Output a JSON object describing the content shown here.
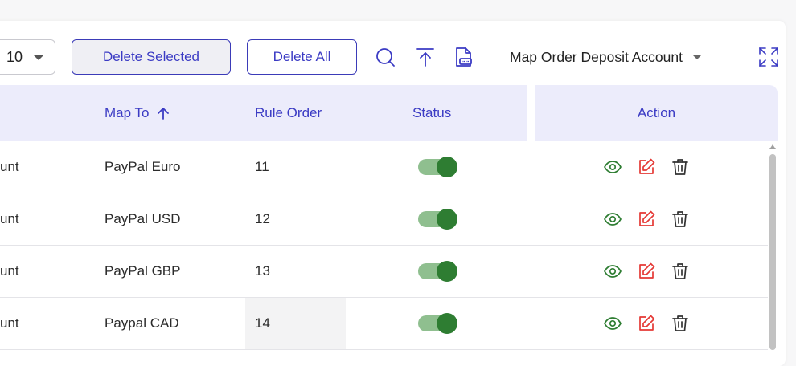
{
  "toolbar": {
    "page_size": "10",
    "delete_selected_label": "Delete Selected",
    "delete_all_label": "Delete All",
    "map_dropdown_label": "Map Order Deposit Account"
  },
  "table": {
    "headers": {
      "map_to": "Map To",
      "rule_order": "Rule Order",
      "status": "Status",
      "action": "Action"
    },
    "rows": [
      {
        "account": "unt",
        "map_to": "PayPal Euro",
        "rule_order": "11",
        "status": true
      },
      {
        "account": "unt",
        "map_to": "PayPal USD",
        "rule_order": "12",
        "status": true
      },
      {
        "account": "unt",
        "map_to": "PayPal GBP",
        "rule_order": "13",
        "status": true
      },
      {
        "account": "unt",
        "map_to": "Paypal CAD",
        "rule_order": "14",
        "status": true
      }
    ]
  },
  "colors": {
    "accent": "#3b3bc4",
    "header_bg": "#ececfb",
    "toggle_on": "#2e7d32",
    "view_icon": "#2e7d32",
    "edit_icon": "#e53935"
  },
  "icons": [
    "search-icon",
    "upload-icon",
    "pdf-export-icon",
    "fullscreen-icon",
    "sort-ascending-icon",
    "view-icon",
    "edit-icon",
    "delete-icon"
  ]
}
